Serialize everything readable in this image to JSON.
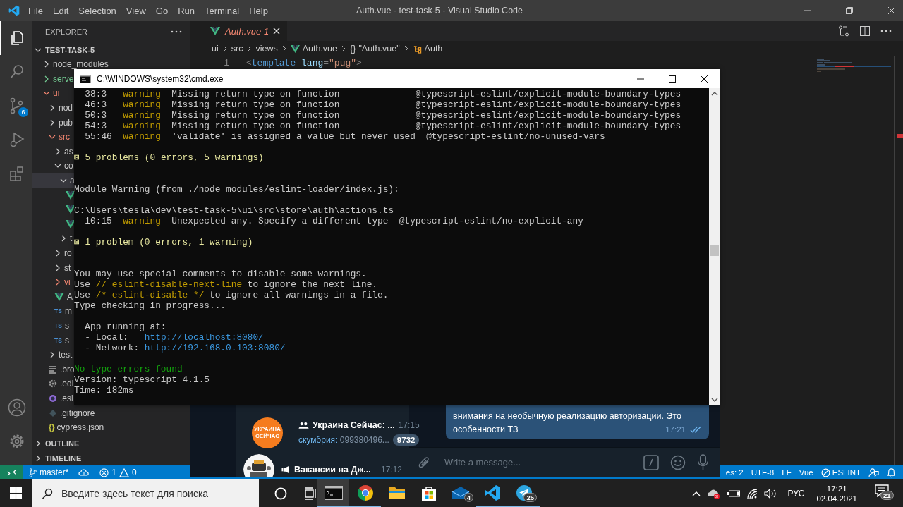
{
  "vscode": {
    "menu": [
      "File",
      "Edit",
      "Selection",
      "View",
      "Go",
      "Run",
      "Terminal",
      "Help"
    ],
    "title": "Auth.vue - test-task-5 - Visual Studio Code",
    "activity_bar": [
      {
        "kind": "explorer",
        "selected": true
      },
      {
        "kind": "search",
        "selected": false
      },
      {
        "kind": "source-control",
        "selected": false,
        "badge": "6"
      },
      {
        "kind": "run",
        "selected": false
      },
      {
        "kind": "extensions",
        "selected": false
      }
    ],
    "activity_bar_bottom": [
      {
        "kind": "account"
      },
      {
        "kind": "settings"
      }
    ],
    "explorer": {
      "title": "EXPLORER",
      "root": {
        "label": "TEST-TASK-5",
        "expanded": true
      },
      "tree": [
        {
          "label": "node_modules",
          "kind": "folder",
          "expanded": false,
          "selected": false
        },
        {
          "label": "serve",
          "kind": "folder",
          "expanded": false,
          "selected": false,
          "color": "#73c991"
        },
        {
          "label": "ui",
          "kind": "folder",
          "expanded": true,
          "selected": false,
          "color": "#f48771",
          "children": [
            {
              "label": "nod",
              "kind": "folder",
              "expanded": false,
              "selected": false
            },
            {
              "label": "pub",
              "kind": "folder",
              "expanded": false,
              "selected": false
            },
            {
              "label": "src",
              "kind": "folder",
              "expanded": true,
              "selected": false,
              "color": "#f48771",
              "children": [
                {
                  "label": "as",
                  "kind": "folder",
                  "expanded": false,
                  "selected": false
                },
                {
                  "label": "co",
                  "kind": "folder",
                  "expanded": true,
                  "selected": false,
                  "children": [
                    {
                      "label": "a",
                      "kind": "folder",
                      "expanded": true,
                      "selected": true,
                      "children": [
                        {
                          "kind": "vue",
                          "selected": false
                        },
                        {
                          "kind": "vue",
                          "selected": false
                        },
                        {
                          "kind": "vue",
                          "selected": false
                        }
                      ]
                    },
                    {
                      "label": "t",
                      "kind": "folder",
                      "expanded": false,
                      "selected": false
                    }
                  ]
                },
                {
                  "label": "ro",
                  "kind": "folder",
                  "expanded": false,
                  "selected": false
                },
                {
                  "label": "st",
                  "kind": "folder",
                  "expanded": false,
                  "selected": false
                },
                {
                  "label": "vi",
                  "kind": "folder",
                  "expanded": false,
                  "selected": false,
                  "color": "#f48771"
                },
                {
                  "label": "A",
                  "kind": "vue",
                  "selected": false
                },
                {
                  "label": "m",
                  "kind": "ts",
                  "icon_label": "TS",
                  "selected": false
                },
                {
                  "label": "s",
                  "kind": "ts",
                  "icon_label": "TS",
                  "selected": false
                },
                {
                  "label": "s",
                  "kind": "ts",
                  "icon_label": "TS",
                  "selected": false
                }
              ]
            },
            {
              "label": "test",
              "kind": "folder",
              "expanded": false,
              "selected": false
            },
            {
              "label": ".bro",
              "kind": "lines",
              "selected": false
            },
            {
              "label": ".edi",
              "kind": "gear",
              "selected": false
            },
            {
              "label": ".esl",
              "kind": "eslint",
              "selected": false
            },
            {
              "label": ".gitignore",
              "kind": "git",
              "selected": false
            },
            {
              "label": "cypress.json",
              "kind": "json",
              "icon_label": "{}",
              "selected": false
            }
          ]
        }
      ],
      "sections": [
        {
          "label": "OUTLINE",
          "expanded": false
        },
        {
          "label": "TIMELINE",
          "expanded": false
        }
      ]
    },
    "tabs": [
      {
        "label": "Auth.vue",
        "problems": "1",
        "selected": true
      }
    ],
    "breadcrumb": [
      {
        "label": "ui",
        "kind": "folder"
      },
      {
        "label": "src",
        "kind": "folder"
      },
      {
        "label": "views",
        "kind": "folder"
      },
      {
        "label": "Auth.vue",
        "kind": "vue"
      },
      {
        "label": "\"Auth.vue\"",
        "kind": "module",
        "symbol": "{}"
      },
      {
        "label": "Auth",
        "kind": "class"
      }
    ],
    "code": [
      {
        "number": "1",
        "tokens": [
          {
            "text": "<",
            "kind": "punct"
          },
          {
            "text": "template",
            "kind": "tag"
          },
          {
            "text": " lang",
            "kind": "attr"
          },
          {
            "text": "=",
            "kind": "punct"
          },
          {
            "text": "\"pug\"",
            "kind": "string"
          },
          {
            "text": ">",
            "kind": "punct"
          }
        ]
      }
    ],
    "status_bar": {
      "branch": "master*",
      "errors": "1",
      "warnings": "0",
      "items": [
        "es: 2",
        "UTF-8",
        "LF",
        "Vue"
      ],
      "linter": "ESLINT"
    }
  },
  "telegram": {
    "chats": [
      {
        "title": "Украина Сейчас: ...",
        "time": "17:15",
        "sender": "скумбрия:",
        "preview": "099380496...",
        "unread": "9732",
        "avatar_text": "УКРАИНА СЕЙЧАС",
        "kind": "group"
      },
      {
        "title": "Вакансии на Дж...",
        "time": "17:12",
        "kind": "channel"
      }
    ],
    "message": {
      "lines": [
        "внимания на необычную реализацию авторизации. Это",
        "особенности ТЗ"
      ],
      "time": "17:21",
      "read": true
    },
    "input": {
      "placeholder": "Write a message..."
    }
  },
  "cmd": {
    "title": "C:\\WINDOWS\\system32\\cmd.exe",
    "lines": [
      {
        "segments": [
          {
            "text": "  38:3   ",
            "kind": "plain"
          },
          {
            "text": "warning",
            "kind": "warn"
          },
          {
            "text": "  Missing return type on function              @typescript-eslint/explicit-module-boundary-types",
            "kind": "plain"
          }
        ]
      },
      {
        "segments": [
          {
            "text": "  46:3   ",
            "kind": "plain"
          },
          {
            "text": "warning",
            "kind": "warn"
          },
          {
            "text": "  Missing return type on function              @typescript-eslint/explicit-module-boundary-types",
            "kind": "plain"
          }
        ]
      },
      {
        "segments": [
          {
            "text": "  50:3   ",
            "kind": "plain"
          },
          {
            "text": "warning",
            "kind": "warn"
          },
          {
            "text": "  Missing return type on function              @typescript-eslint/explicit-module-boundary-types",
            "kind": "plain"
          }
        ]
      },
      {
        "segments": [
          {
            "text": "  54:3   ",
            "kind": "plain"
          },
          {
            "text": "warning",
            "kind": "warn"
          },
          {
            "text": "  Missing return type on function              @typescript-eslint/explicit-module-boundary-types",
            "kind": "plain"
          }
        ]
      },
      {
        "segments": [
          {
            "text": "  55:46  ",
            "kind": "plain"
          },
          {
            "text": "warning",
            "kind": "warn"
          },
          {
            "text": "  'validate' is assigned a value but never used  @typescript-eslint/no-unused-vars",
            "kind": "plain"
          }
        ]
      },
      {
        "kind": "blank"
      },
      {
        "segments": [
          {
            "text": "⊠ 5 problems (0 errors, 5 warnings)",
            "kind": "info"
          }
        ]
      },
      {
        "kind": "blank"
      },
      {
        "kind": "blank"
      },
      {
        "segments": [
          {
            "text": "Module Warning (from ./node_modules/eslint-loader/index.js):",
            "kind": "plain"
          }
        ]
      },
      {
        "kind": "blank"
      },
      {
        "segments": [
          {
            "text": "C:\\Users\\tesla\\dev\\test-task-5\\ui\\src\\store\\auth\\actions.ts",
            "kind": "path"
          }
        ]
      },
      {
        "segments": [
          {
            "text": "  10:15  ",
            "kind": "plain"
          },
          {
            "text": "warning",
            "kind": "warn"
          },
          {
            "text": "  Unexpected any. Specify a different type  @typescript-eslint/no-explicit-any",
            "kind": "plain"
          }
        ]
      },
      {
        "kind": "blank"
      },
      {
        "segments": [
          {
            "text": "⊠ 1 problem (0 errors, 1 warning)",
            "kind": "info"
          }
        ]
      },
      {
        "kind": "blank"
      },
      {
        "kind": "blank"
      },
      {
        "segments": [
          {
            "text": "You may use special comments to disable some warnings.",
            "kind": "plain"
          }
        ]
      },
      {
        "segments": [
          {
            "text": "Use ",
            "kind": "plain"
          },
          {
            "text": "// eslint-disable-next-line",
            "kind": "warn"
          },
          {
            "text": " to ignore the next line.",
            "kind": "plain"
          }
        ]
      },
      {
        "segments": [
          {
            "text": "Use ",
            "kind": "plain"
          },
          {
            "text": "/* eslint-disable */",
            "kind": "warn"
          },
          {
            "text": " to ignore all warnings in a file.",
            "kind": "plain"
          }
        ]
      },
      {
        "segments": [
          {
            "text": "Type checking in progress...",
            "kind": "plain"
          }
        ]
      },
      {
        "kind": "blank"
      },
      {
        "segments": [
          {
            "text": "  App running at:",
            "kind": "plain"
          }
        ]
      },
      {
        "segments": [
          {
            "text": "  - Local:   ",
            "kind": "plain"
          },
          {
            "text": "http://localhost:8080/",
            "kind": "link"
          }
        ]
      },
      {
        "segments": [
          {
            "text": "  - Network: ",
            "kind": "plain"
          },
          {
            "text": "http://192.168.0.103:8080/",
            "kind": "link"
          }
        ]
      },
      {
        "kind": "blank"
      },
      {
        "segments": [
          {
            "text": "No type errors found",
            "kind": "ok"
          }
        ]
      },
      {
        "segments": [
          {
            "text": "Version: typescript 4.1.5",
            "kind": "plain"
          }
        ]
      },
      {
        "segments": [
          {
            "text": "Time: 182ms",
            "kind": "plain"
          }
        ]
      }
    ]
  },
  "taskbar": {
    "search_placeholder": "Введите здесь текст для поиска",
    "apps": [
      {
        "kind": "cmd",
        "active": true,
        "running": true
      },
      {
        "kind": "chrome",
        "active": false,
        "running": true
      },
      {
        "kind": "folder",
        "active": false,
        "running": false
      },
      {
        "kind": "store",
        "active": false,
        "running": false
      },
      {
        "kind": "mail",
        "active": false,
        "running": false,
        "badge": "4"
      },
      {
        "kind": "vscode",
        "active": false,
        "running": true
      },
      {
        "kind": "telegram",
        "active": false,
        "running": true,
        "badge": "25"
      }
    ],
    "tray": {
      "language": "РУС",
      "time": "17:21",
      "date": "02.04.2021",
      "notifications": "21"
    }
  }
}
